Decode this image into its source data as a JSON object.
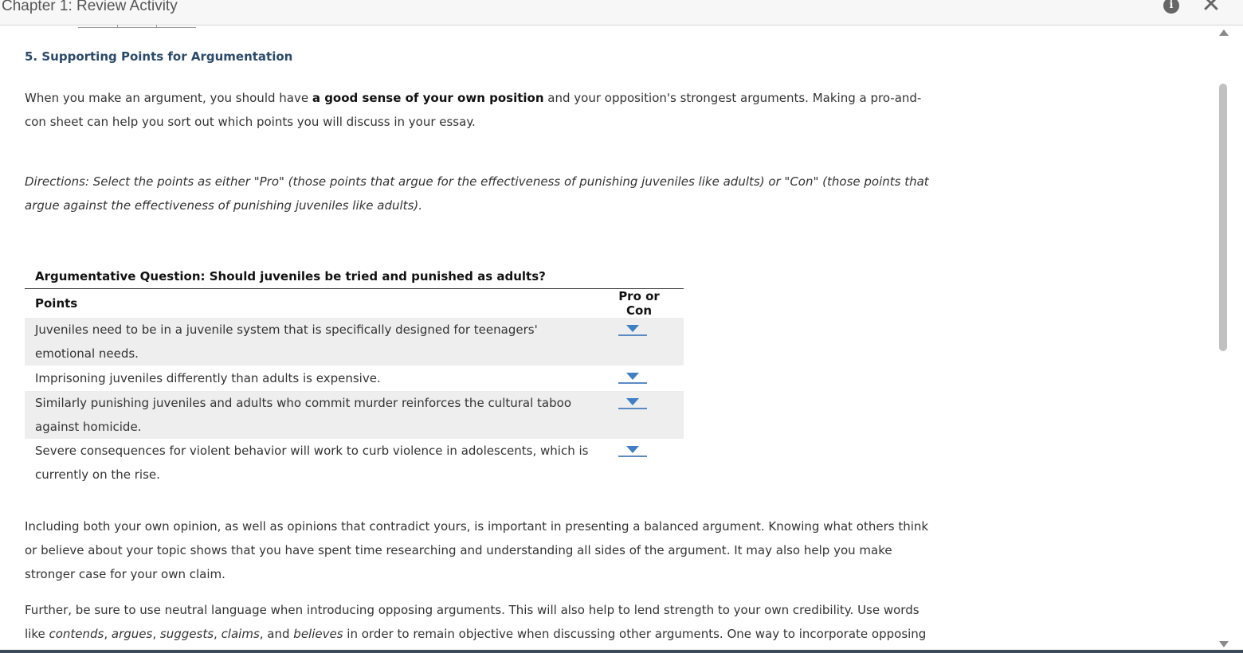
{
  "window": {
    "title": "Chapter 1: Review Activity",
    "info_icon": "info-icon",
    "close_icon": "close-icon",
    "info_glyph": "i",
    "close_glyph": "✕"
  },
  "section": {
    "title": "5. Supporting Points for Argumentation",
    "intro": {
      "pre": "When you make an argument, you should have ",
      "bold": "a good sense of your own position",
      "post": " and your opposition's strongest arguments. Making a pro-and-con sheet can help you sort out which points you will discuss in your essay."
    },
    "directions": "Directions: Select the points as either \"Pro\" (those points that argue for the effectiveness of punishing juveniles like adults) or \"Con\" (those points that argue against the effectiveness of punishing juveniles like adults)."
  },
  "table": {
    "caption": "Argumentative Question: Should juveniles be tried and punished as adults?",
    "col_points": "Points",
    "col_procon": "Pro or Con",
    "rows": [
      {
        "point": "Juveniles need to be in a juvenile system that is specifically designed for teenagers' emotional needs.",
        "selected": ""
      },
      {
        "point": "Imprisoning juveniles differently than adults is expensive.",
        "selected": ""
      },
      {
        "point": "Similarly punishing juveniles and adults who commit murder reinforces the cultural taboo against homicide.",
        "selected": ""
      },
      {
        "point": "Severe consequences for violent behavior will work to curb violence in adolescents, which is currently on the rise.",
        "selected": ""
      }
    ]
  },
  "body": {
    "para1": "Including both your own opinion, as well as opinions that contradict yours, is important in presenting a balanced argument. Knowing what others think or believe about your topic shows that you have spent time researching and understanding all sides of the argument. It may also help you make stronger case for your own claim.",
    "para2": {
      "t1": "Further, be sure to use neutral language when introducing opposing arguments. This will also help to lend strength to your own credibility. Use words like ",
      "w1": "contends",
      "s1": ", ",
      "w2": "argues",
      "s2": ", ",
      "w3": "suggests",
      "s3": ", ",
      "w4": "claims",
      "s4": ", and ",
      "w5": "believes",
      "t2": " in order to remain objective when discussing other arguments. One way to incorporate opposing"
    }
  },
  "colors": {
    "heading": "#2a4a6a",
    "dropdown_accent": "#3f7fc4",
    "row_shade": "#eeeeee"
  }
}
